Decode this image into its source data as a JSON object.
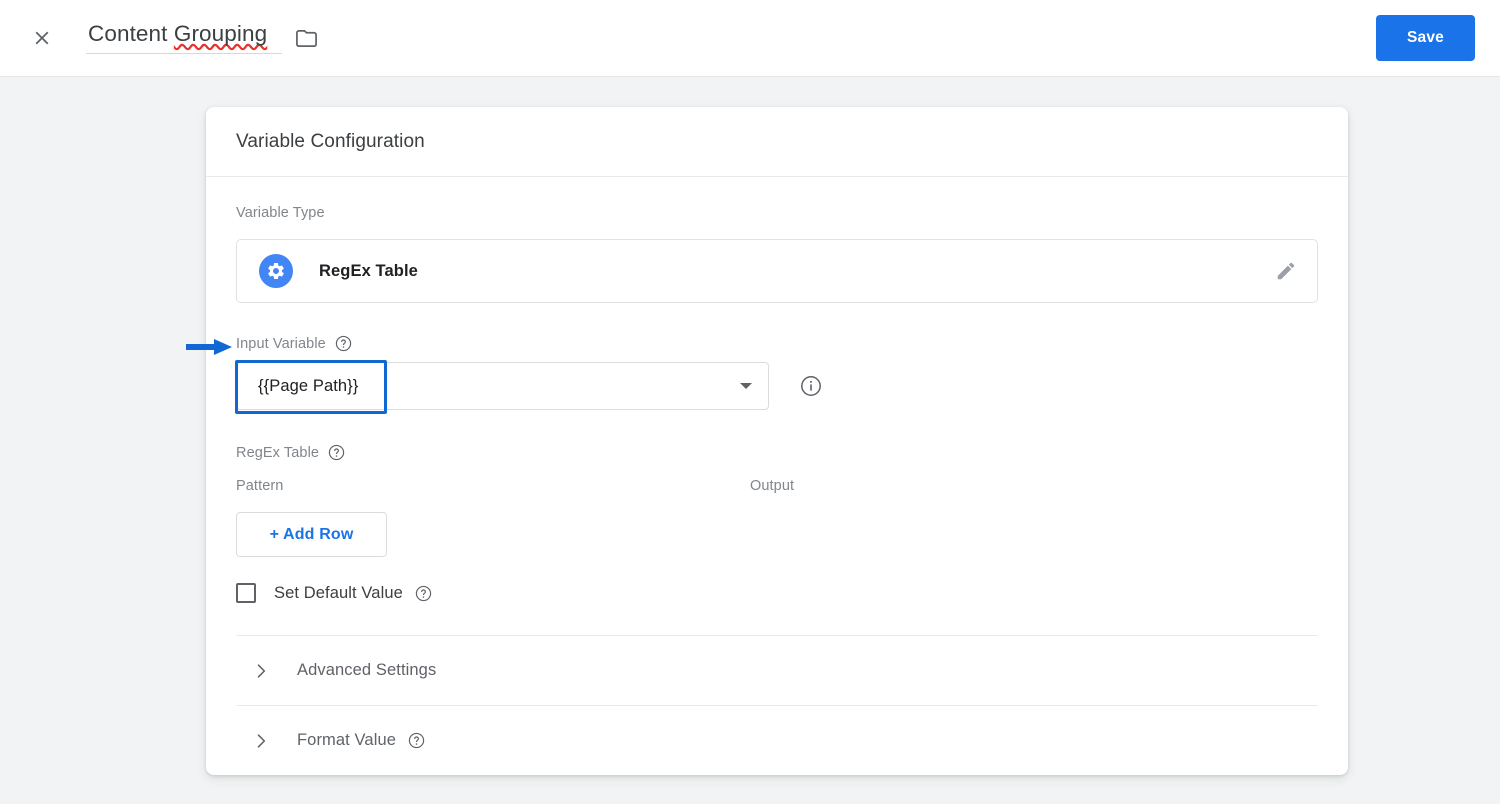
{
  "topbar": {
    "close_icon": "close-icon",
    "title_prefix": "Content ",
    "title_misspelled_word": "Grouping",
    "title_full": "Content Grouping",
    "folder_icon": "folder-icon",
    "save_label": "Save"
  },
  "card": {
    "header_title": "Variable Configuration",
    "variable_type": {
      "label": "Variable Type",
      "icon": "gear-icon",
      "name": "RegEx Table",
      "edit_icon": "pencil-icon"
    },
    "input_variable": {
      "label": "Input Variable",
      "help_icon": "help-icon",
      "value": "{{Page Path}}",
      "dropdown_icon": "chevron-down-icon",
      "info_icon": "info-icon"
    },
    "regex_table": {
      "label": "RegEx Table",
      "help_icon": "help-icon",
      "columns": [
        "Pattern",
        "Output"
      ],
      "rows": [],
      "add_row_label": "+ Add Row"
    },
    "set_default_value": {
      "label": "Set Default Value",
      "checked": false,
      "help_icon": "help-icon"
    },
    "sections": [
      {
        "label": "Advanced Settings",
        "expanded": false,
        "has_help": false
      },
      {
        "label": "Format Value",
        "expanded": false,
        "has_help": true
      }
    ]
  },
  "annotations": {
    "arrow_color": "#1268d3",
    "highlight_color": "#1268d3",
    "arrow_target": "Input Variable",
    "highlight_target": "{{Page Path}}"
  },
  "colors": {
    "accent_blue": "#1a73e8",
    "icon_blue": "#4285f4",
    "page_bg": "#f1f3f4",
    "card_bg": "#ffffff",
    "label_gray": "#80868b",
    "text_dark": "#202124"
  }
}
